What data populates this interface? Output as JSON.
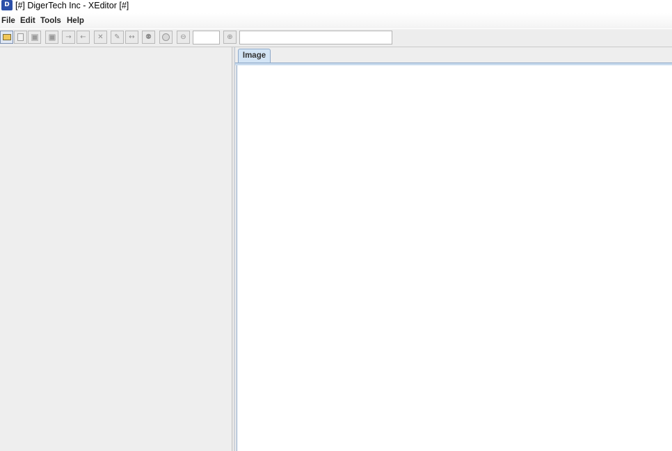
{
  "window": {
    "title": "[#] DigerTech Inc - XEditor [#]",
    "icon": "app-logo-icon",
    "icon_text": "D"
  },
  "menu": [
    {
      "label": "File"
    },
    {
      "label": "Edit"
    },
    {
      "label": "Tools"
    },
    {
      "label": "Help"
    }
  ],
  "toolbar": {
    "buttons": [
      {
        "icon": "open-folder-icon"
      },
      {
        "icon": "new-document-icon"
      },
      {
        "icon": "save-icon"
      },
      {
        "icon": "print-icon"
      },
      {
        "icon": "redo-arrow-icon",
        "glyph": "→"
      },
      {
        "icon": "undo-arrow-icon",
        "glyph": "←"
      },
      {
        "icon": "delete-x-icon",
        "glyph": "✕"
      },
      {
        "icon": "edit-pencil-icon",
        "glyph": "✎"
      },
      {
        "icon": "split-icon",
        "glyph": "↔"
      },
      {
        "icon": "binoculars-find-icon",
        "glyph": "⚉"
      },
      {
        "icon": "globe-icon"
      },
      {
        "icon": "zoom-out-icon",
        "glyph": "⊖"
      },
      {
        "icon": "zoom-in-icon",
        "glyph": "⊕"
      }
    ],
    "zoom_value": "",
    "search_value": ""
  },
  "tabs": [
    {
      "label": "Image"
    }
  ],
  "colors": {
    "tab_active": "#d3e4f5",
    "tab_border": "#8ea8c8",
    "panel_bg": "#eeeeee",
    "app_icon": "#2b4fa8"
  }
}
